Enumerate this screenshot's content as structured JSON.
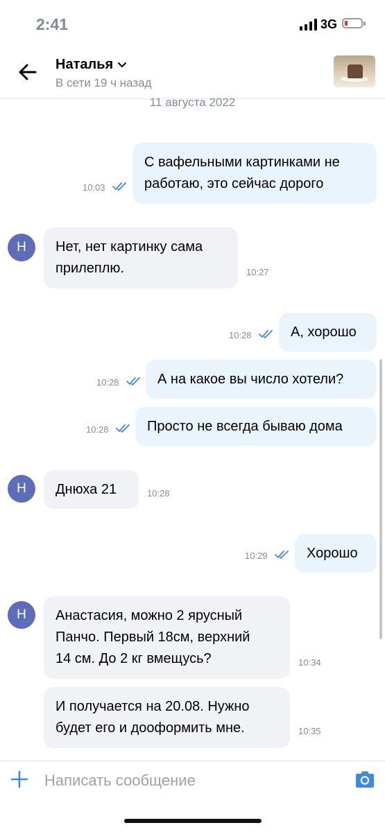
{
  "status_bar": {
    "time": "2:41",
    "network": "3G"
  },
  "header": {
    "name": "Наталья",
    "subtitle": "В сети 19 ч назад"
  },
  "date_separator": "11 августа 2022",
  "contact_avatar_letter": "Н",
  "messages": [
    {
      "direction": "out",
      "line1": "С вафельными картинками не",
      "line2": "работаю, это сейчас дорого",
      "time": "10:03",
      "read": true
    },
    {
      "direction": "in",
      "line1": "Нет, нет картинку сама",
      "line2": "прилеплю.",
      "time": "10:27"
    },
    {
      "direction": "out",
      "text": "А, хорошо",
      "time": "10:28",
      "read": true
    },
    {
      "direction": "out",
      "text": "А на какое вы число хотели?",
      "time": "10:28",
      "read": true
    },
    {
      "direction": "out",
      "text": "Просто не всегда бываю дома",
      "time": "10:28",
      "read": true
    },
    {
      "direction": "in",
      "text": "Днюха 21",
      "time": "10:28"
    },
    {
      "direction": "out",
      "text": "Хорошо",
      "time": "10:29",
      "read": true
    },
    {
      "direction": "in",
      "line1": "Анастасия, можно 2 ярусный",
      "line2": "Панчо.  Первый 18см, верхний",
      "line3": "14 см. До 2 кг вмещусь?",
      "time": "10:34"
    },
    {
      "direction": "in",
      "line1": "И получается на 20.08. Нужно",
      "line2": "будет его и дооформить мне.",
      "time": "10:35"
    }
  ],
  "composer": {
    "placeholder": "Написать сообщение"
  },
  "colors": {
    "accent": "#3f8ae0",
    "outgoing_bubble": "#e9f4fd",
    "incoming_bubble": "#f0f2f5",
    "avatar": "#5f6cb8"
  }
}
